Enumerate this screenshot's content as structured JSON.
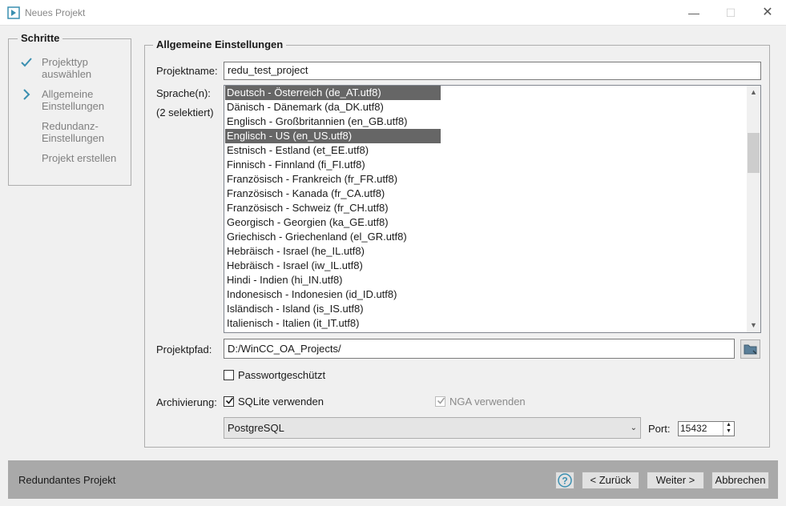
{
  "window": {
    "title": "Neues Projekt",
    "minimize": "—",
    "maximize": "☐",
    "close": "✕"
  },
  "steps": {
    "title": "Schritte",
    "items": [
      {
        "label": "Projekttyp auswählen",
        "state": "done"
      },
      {
        "label": "Allgemeine Einstellungen",
        "state": "current"
      },
      {
        "label": "Redundanz-Einstellungen",
        "state": "pending"
      },
      {
        "label": "Projekt erstellen",
        "state": "pending"
      }
    ]
  },
  "general": {
    "title": "Allgemeine Einstellungen",
    "project_name_label": "Projektname:",
    "project_name_value": "redu_test_project",
    "languages_label": "Sprache(n):",
    "languages_selected": "(2 selektiert)",
    "languages": [
      {
        "label": "Deutsch - Österreich (de_AT.utf8)",
        "selected": true
      },
      {
        "label": "Dänisch - Dänemark (da_DK.utf8)",
        "selected": false
      },
      {
        "label": "Englisch - Großbritannien (en_GB.utf8)",
        "selected": false
      },
      {
        "label": "Englisch - US (en_US.utf8)",
        "selected": true
      },
      {
        "label": "Estnisch - Estland (et_EE.utf8)",
        "selected": false
      },
      {
        "label": "Finnisch - Finnland (fi_FI.utf8)",
        "selected": false
      },
      {
        "label": "Französisch - Frankreich (fr_FR.utf8)",
        "selected": false
      },
      {
        "label": "Französisch - Kanada (fr_CA.utf8)",
        "selected": false
      },
      {
        "label": "Französisch - Schweiz (fr_CH.utf8)",
        "selected": false
      },
      {
        "label": "Georgisch - Georgien (ka_GE.utf8)",
        "selected": false
      },
      {
        "label": "Griechisch - Griechenland (el_GR.utf8)",
        "selected": false
      },
      {
        "label": "Hebräisch - Israel (he_IL.utf8)",
        "selected": false
      },
      {
        "label": "Hebräisch - Israel (iw_IL.utf8)",
        "selected": false
      },
      {
        "label": "Hindi - Indien (hi_IN.utf8)",
        "selected": false
      },
      {
        "label": "Indonesisch - Indonesien (id_ID.utf8)",
        "selected": false
      },
      {
        "label": "Isländisch - Island (is_IS.utf8)",
        "selected": false
      },
      {
        "label": "Italienisch - Italien (it_IT.utf8)",
        "selected": false
      }
    ],
    "path_label": "Projektpfad:",
    "path_value": "D:/WinCC_OA_Projects/",
    "password_label": "Passwortgeschützt",
    "password_checked": false,
    "archiving_label": "Archivierung:",
    "sqlite_label": "SQLite verwenden",
    "sqlite_checked": true,
    "nga_label": "NGA verwenden",
    "nga_checked": true,
    "db_select_value": "PostgreSQL",
    "port_label": "Port:",
    "port_value": "15432"
  },
  "footer": {
    "label": "Redundantes Projekt",
    "help": "?",
    "back": "< Zurück",
    "next": "Weiter >",
    "cancel": "Abbrechen"
  },
  "colors": {
    "accent_check": "#3a8fb0",
    "selection": "#666666",
    "footer_bg": "#a9a9a9"
  }
}
